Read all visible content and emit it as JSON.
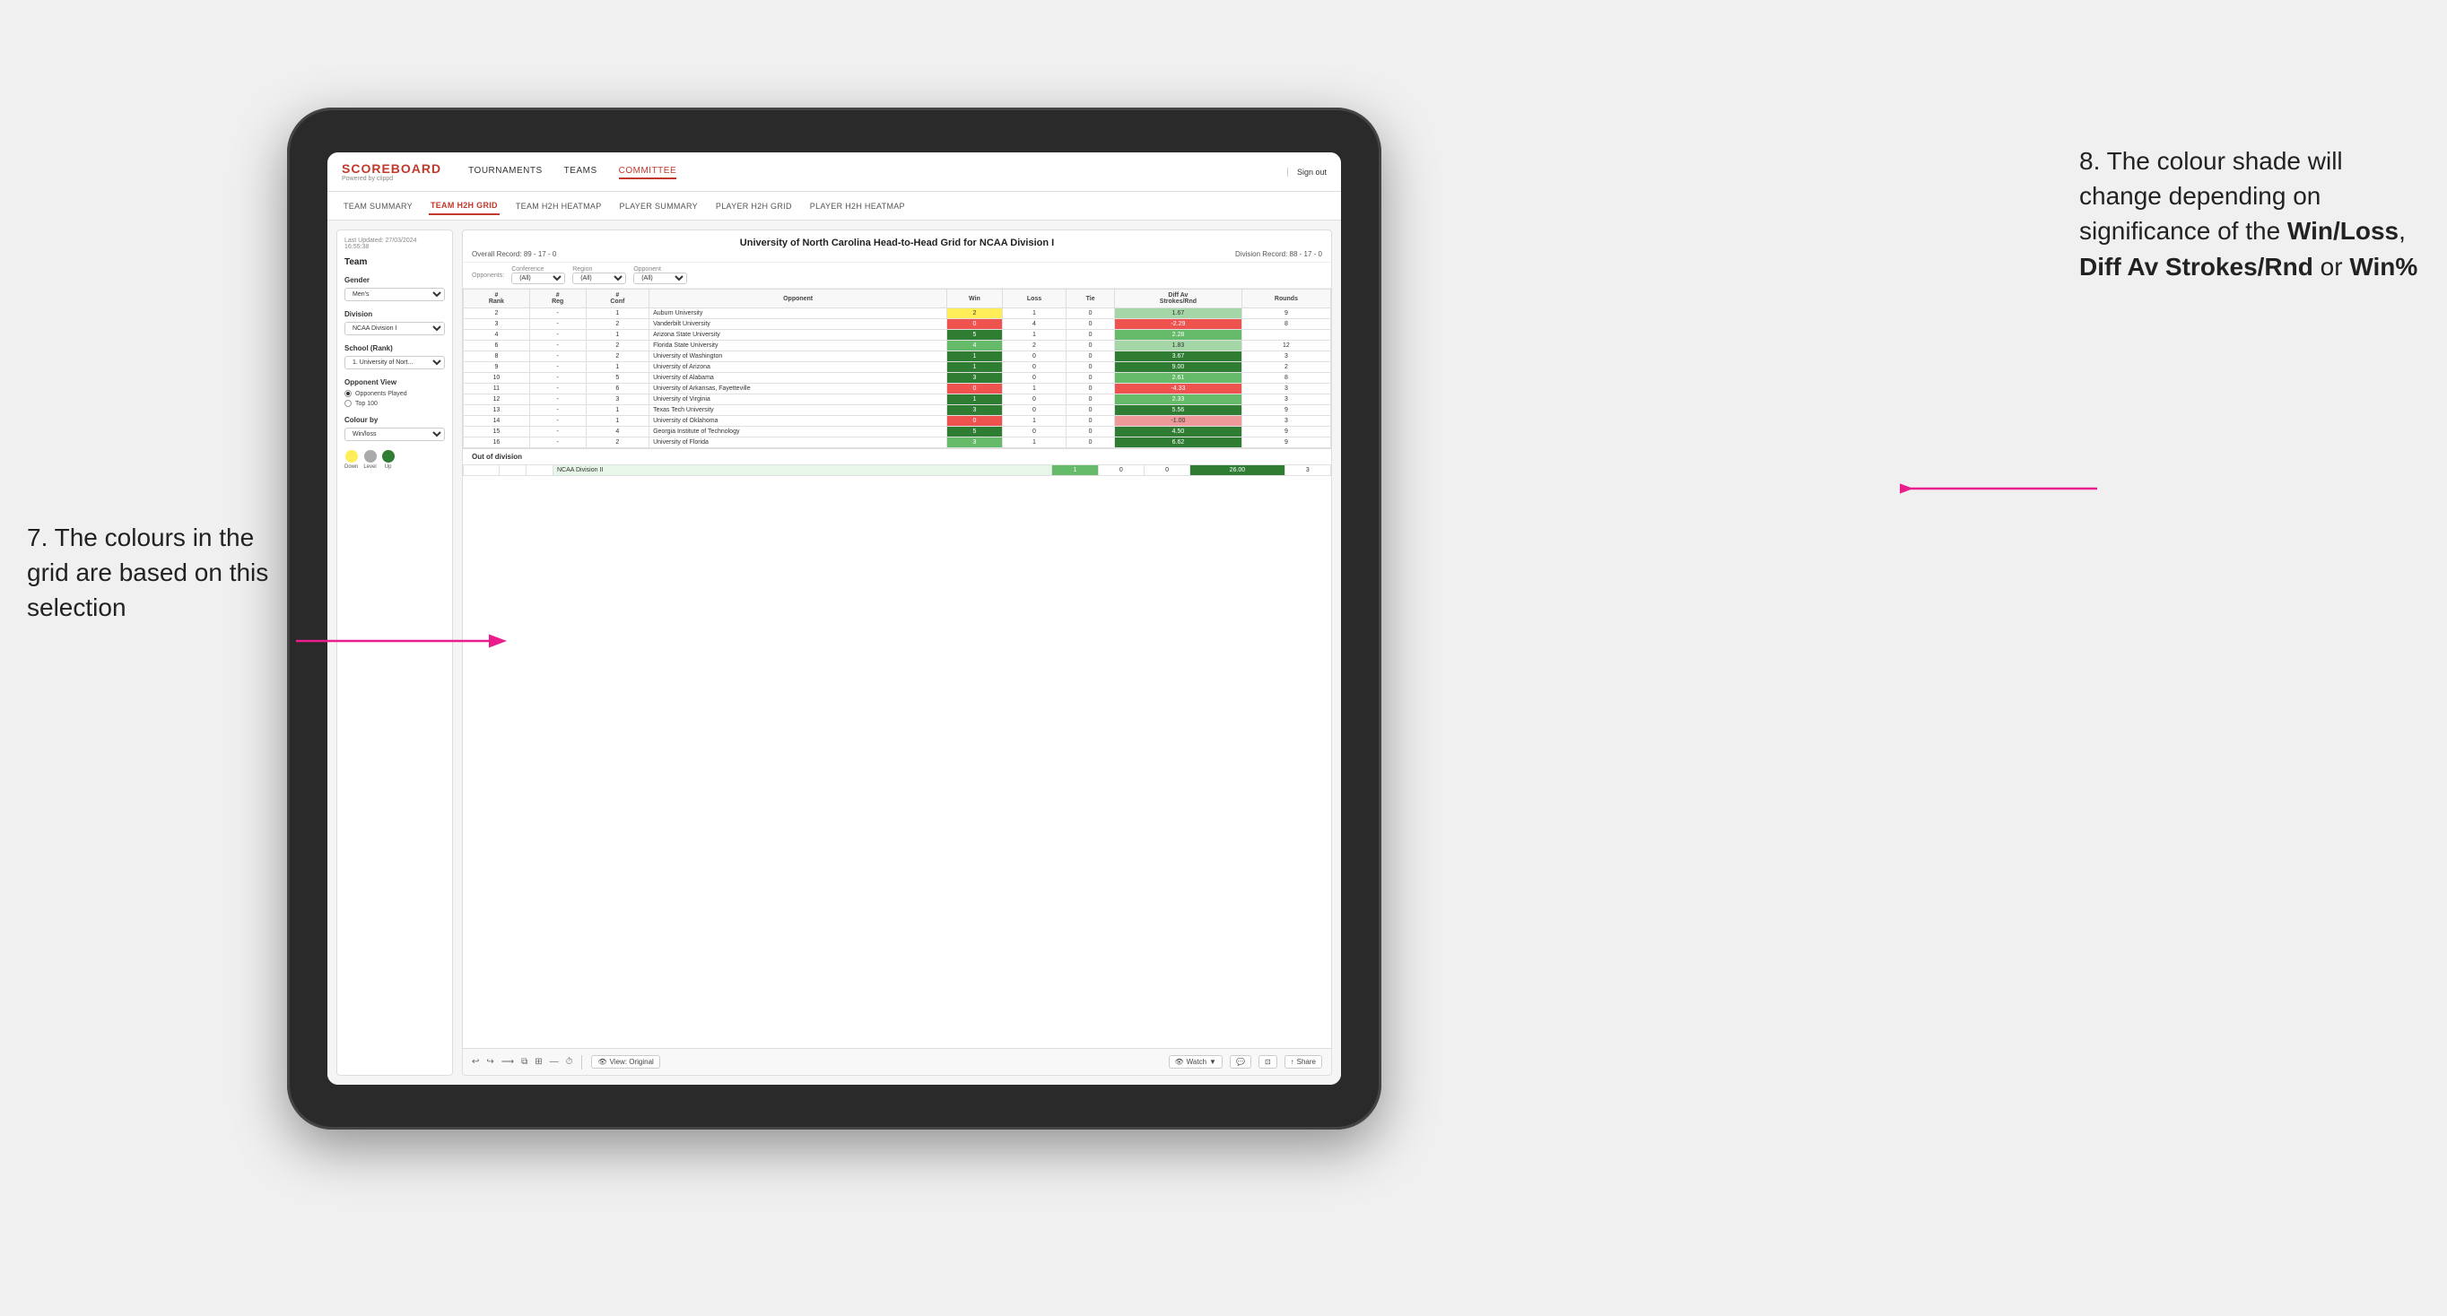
{
  "annotations": {
    "left_title": "7. The colours in the grid are based on this selection",
    "right_title": "8. The colour shade will change depending on significance of the",
    "right_bold1": "Win/Loss",
    "right_sep1": ", ",
    "right_bold2": "Diff Av Strokes/Rnd",
    "right_sep2": " or",
    "right_bold3": "Win%"
  },
  "nav": {
    "logo": "SCOREBOARD",
    "logo_sub": "Powered by clippd",
    "links": [
      "TOURNAMENTS",
      "TEAMS",
      "COMMITTEE"
    ],
    "sign_out": "Sign out"
  },
  "sub_nav": {
    "items": [
      "TEAM SUMMARY",
      "TEAM H2H GRID",
      "TEAM H2H HEATMAP",
      "PLAYER SUMMARY",
      "PLAYER H2H GRID",
      "PLAYER H2H HEATMAP"
    ],
    "active": "TEAM H2H GRID"
  },
  "left_panel": {
    "last_updated_label": "Last Updated: 27/03/2024",
    "last_updated_time": "16:55:38",
    "team_label": "Team",
    "gender_label": "Gender",
    "gender_value": "Men's",
    "division_label": "Division",
    "division_value": "NCAA Division I",
    "school_label": "School (Rank)",
    "school_value": "1. University of Nort...",
    "opponent_view_label": "Opponent View",
    "opponent_view_options": [
      "Opponents Played",
      "Top 100"
    ],
    "colour_by_label": "Colour by",
    "colour_by_value": "Win/loss",
    "legend": {
      "down_label": "Down",
      "level_label": "Level",
      "up_label": "Up"
    }
  },
  "grid": {
    "title": "University of North Carolina Head-to-Head Grid for NCAA Division I",
    "overall_record_label": "Overall Record:",
    "overall_record": "89 - 17 - 0",
    "division_record_label": "Division Record:",
    "division_record": "88 - 17 - 0",
    "filters": {
      "opponents_label": "Opponents:",
      "opponents_value": "(All)",
      "conference_label": "Conference",
      "conference_value": "(All)",
      "region_label": "Region",
      "region_value": "(All)",
      "opponent_label": "Opponent",
      "opponent_value": "(All)"
    },
    "columns": [
      "#\nRank",
      "#\nReg",
      "#\nConf",
      "Opponent",
      "Win",
      "Loss",
      "Tie",
      "Diff Av\nStrokes/Rnd",
      "Rounds"
    ],
    "rows": [
      {
        "rank": "2",
        "reg": "-",
        "conf": "1",
        "opponent": "Auburn University",
        "win": "2",
        "loss": "1",
        "tie": "0",
        "diff": "1.67",
        "rounds": "9",
        "win_color": "yellow",
        "diff_color": "green_light"
      },
      {
        "rank": "3",
        "reg": "-",
        "conf": "2",
        "opponent": "Vanderbilt University",
        "win": "0",
        "loss": "4",
        "tie": "0",
        "diff": "-2.29",
        "rounds": "8",
        "win_color": "red",
        "diff_color": "red"
      },
      {
        "rank": "4",
        "reg": "-",
        "conf": "1",
        "opponent": "Arizona State University",
        "win": "5",
        "loss": "1",
        "tie": "0",
        "diff": "2.28",
        "rounds": "",
        "win_color": "green_dark",
        "diff_color": "green"
      },
      {
        "rank": "6",
        "reg": "-",
        "conf": "2",
        "opponent": "Florida State University",
        "win": "4",
        "loss": "2",
        "tie": "0",
        "diff": "1.83",
        "rounds": "12",
        "win_color": "green",
        "diff_color": "green_light"
      },
      {
        "rank": "8",
        "reg": "-",
        "conf": "2",
        "opponent": "University of Washington",
        "win": "1",
        "loss": "0",
        "tie": "0",
        "diff": "3.67",
        "rounds": "3",
        "win_color": "green_dark",
        "diff_color": "green_dark"
      },
      {
        "rank": "9",
        "reg": "-",
        "conf": "1",
        "opponent": "University of Arizona",
        "win": "1",
        "loss": "0",
        "tie": "0",
        "diff": "9.00",
        "rounds": "2",
        "win_color": "green_dark",
        "diff_color": "green_dark"
      },
      {
        "rank": "10",
        "reg": "-",
        "conf": "5",
        "opponent": "University of Alabama",
        "win": "3",
        "loss": "0",
        "tie": "0",
        "diff": "2.61",
        "rounds": "8",
        "win_color": "green_dark",
        "diff_color": "green"
      },
      {
        "rank": "11",
        "reg": "-",
        "conf": "6",
        "opponent": "University of Arkansas, Fayetteville",
        "win": "0",
        "loss": "1",
        "tie": "0",
        "diff": "-4.33",
        "rounds": "3",
        "win_color": "red",
        "diff_color": "red"
      },
      {
        "rank": "12",
        "reg": "-",
        "conf": "3",
        "opponent": "University of Virginia",
        "win": "1",
        "loss": "0",
        "tie": "0",
        "diff": "2.33",
        "rounds": "3",
        "win_color": "green_dark",
        "diff_color": "green"
      },
      {
        "rank": "13",
        "reg": "-",
        "conf": "1",
        "opponent": "Texas Tech University",
        "win": "3",
        "loss": "0",
        "tie": "0",
        "diff": "5.56",
        "rounds": "9",
        "win_color": "green_dark",
        "diff_color": "green_dark"
      },
      {
        "rank": "14",
        "reg": "-",
        "conf": "1",
        "opponent": "University of Oklahoma",
        "win": "0",
        "loss": "1",
        "tie": "0",
        "diff": "-1.00",
        "rounds": "3",
        "win_color": "red",
        "diff_color": "red_light"
      },
      {
        "rank": "15",
        "reg": "-",
        "conf": "4",
        "opponent": "Georgia Institute of Technology",
        "win": "5",
        "loss": "0",
        "tie": "0",
        "diff": "4.50",
        "rounds": "9",
        "win_color": "green_dark",
        "diff_color": "green_dark"
      },
      {
        "rank": "16",
        "reg": "-",
        "conf": "2",
        "opponent": "University of Florida",
        "win": "3",
        "loss": "1",
        "tie": "0",
        "diff": "6.62",
        "rounds": "9",
        "win_color": "green",
        "diff_color": "green_dark"
      }
    ],
    "out_of_division_label": "Out of division",
    "out_of_division_rows": [
      {
        "name": "NCAA Division II",
        "win": "1",
        "loss": "0",
        "tie": "0",
        "diff": "26.00",
        "rounds": "3"
      }
    ]
  },
  "toolbar": {
    "view_label": "View: Original",
    "watch_label": "Watch",
    "share_label": "Share"
  }
}
